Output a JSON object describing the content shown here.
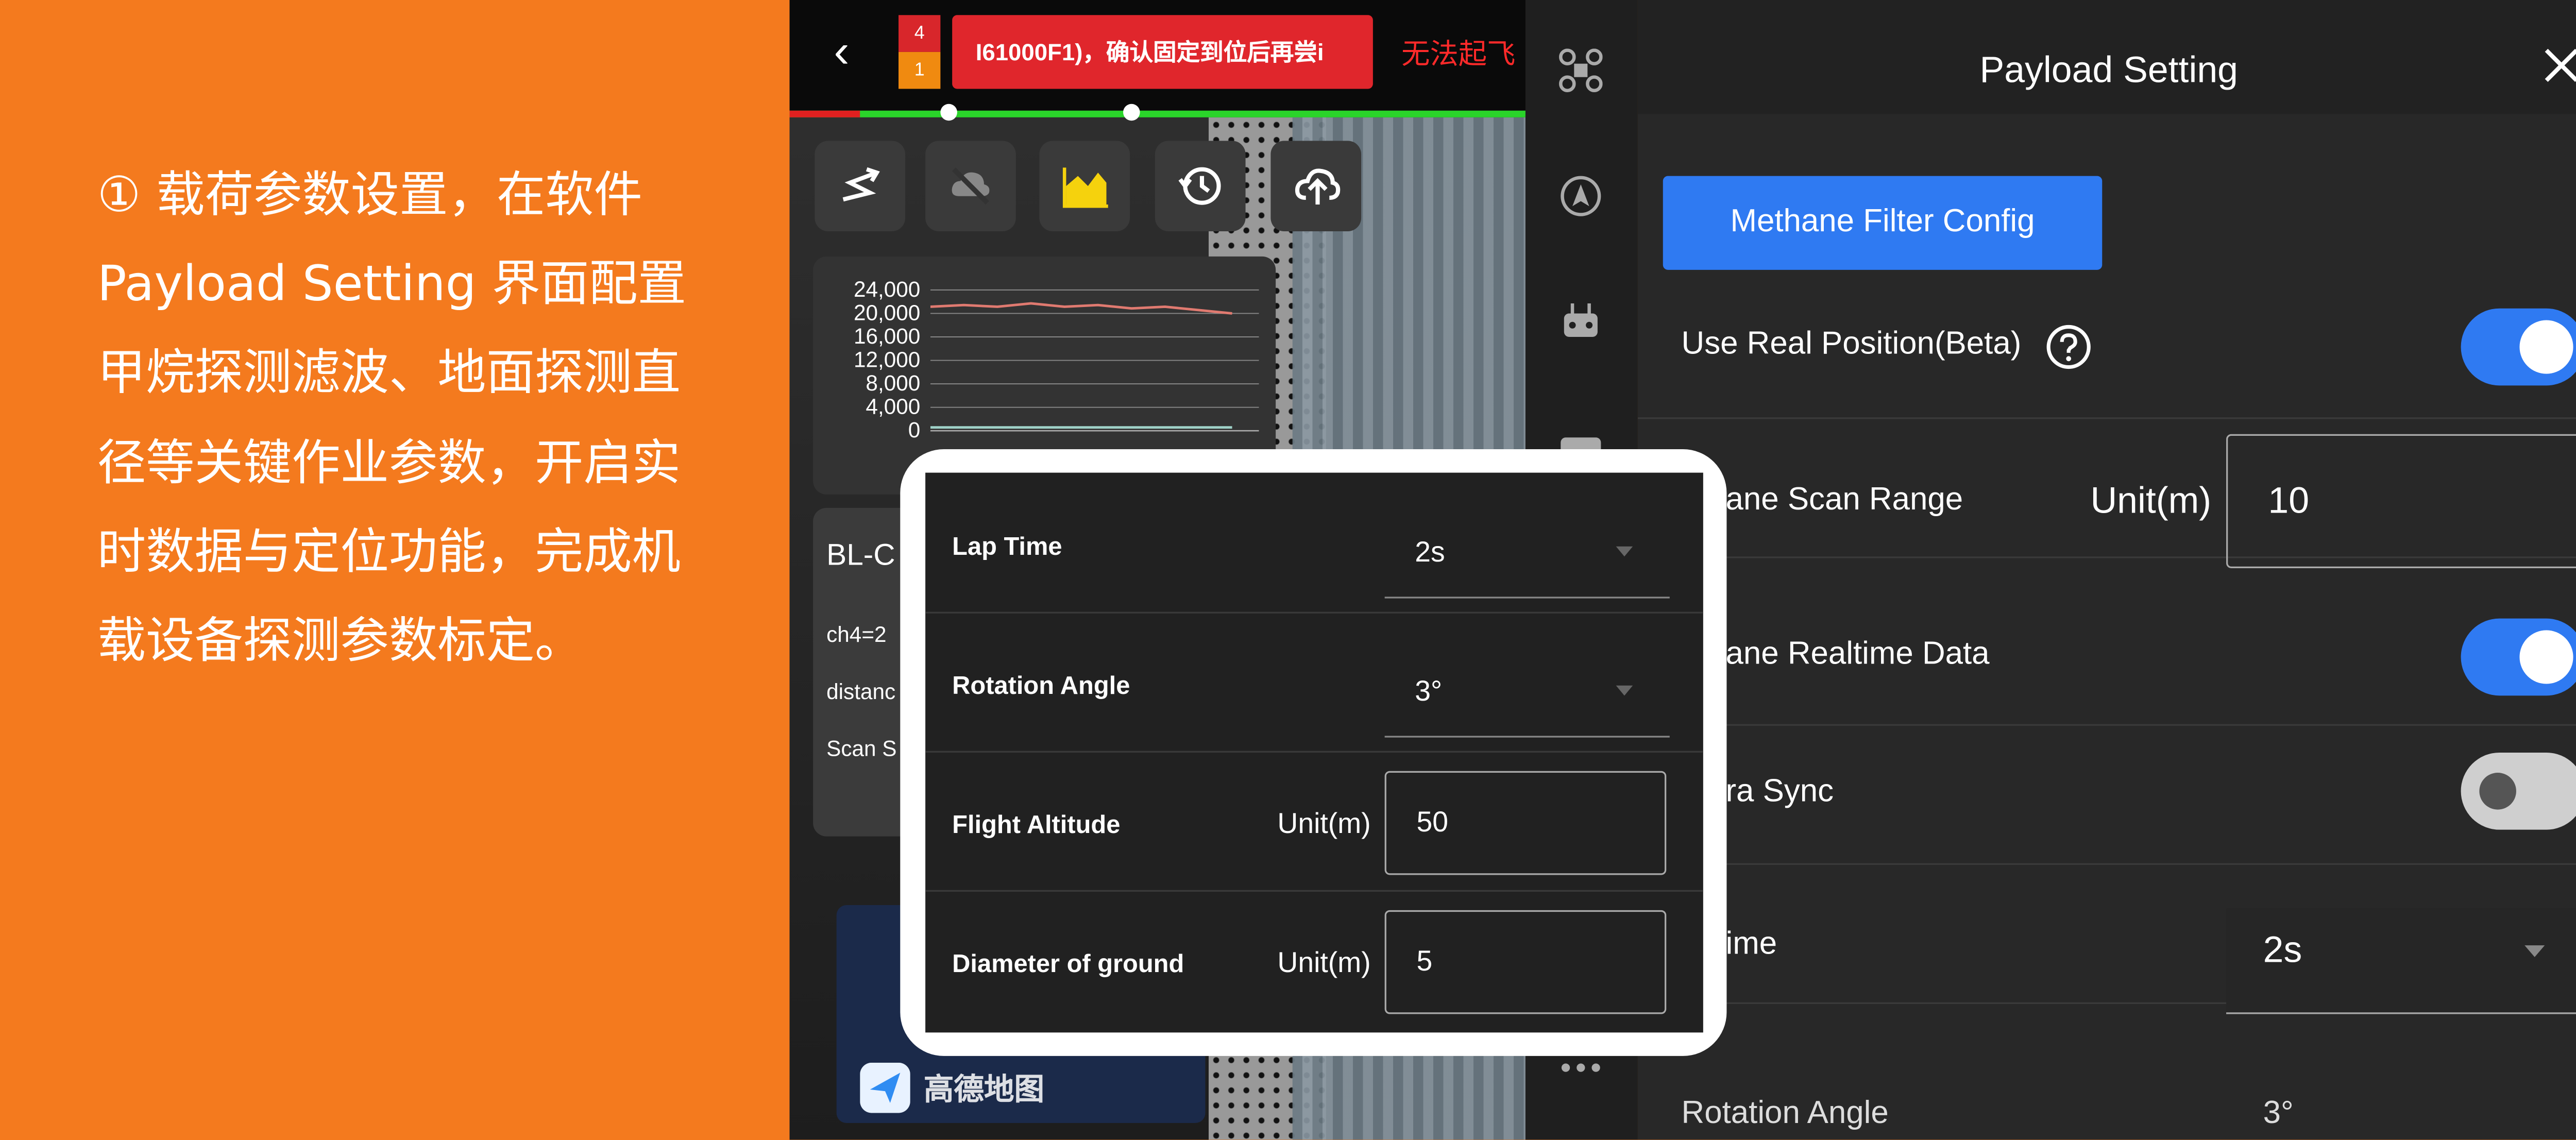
{
  "caption": {
    "lines": [
      "① 载荷参数设置，在软件",
      "Payload Setting 界面配置",
      "甲烷探测滤波、地面探测直",
      "径等关键作业参数，开启实",
      "时数据与定位功能，完成机",
      "载设备探测参数标定。"
    ]
  },
  "app": {
    "badge_top": "4",
    "badge_bottom": "1",
    "warning": "I61000F1)，确认固定到位后再尝i",
    "warning_red": "无法起飞",
    "chart": {
      "ticks": [
        "24,000",
        "20,000",
        "16,000",
        "12,000",
        "8,000",
        "4,000",
        "0"
      ]
    },
    "bl_title": "BL-C",
    "bl_lines": [
      "ch4=2",
      "distanc",
      "Scan S"
    ],
    "map_text": "高德地图"
  },
  "overlay": {
    "rows": [
      {
        "label": "Lap Time",
        "value": "2s"
      },
      {
        "label": "Rotation Angle",
        "value": "3°"
      },
      {
        "label": "Flight Altitude",
        "unit": "Unit(m)",
        "value": "50"
      },
      {
        "label": "Diameter of ground",
        "unit": "Unit(m)",
        "value": "5"
      }
    ]
  },
  "panel": {
    "title": "Payload Setting",
    "filter_button": "Methane Filter Config",
    "use_real_position": "Use Real Position(Beta)",
    "scan_range_label": "ethane Scan Range",
    "scan_range_unit": "Unit(m)",
    "scan_range_value": "10",
    "realtime_label": "ethane Realtime Data",
    "camera_sync_label": "mera Sync",
    "lap_time_label": "p Time",
    "lap_time_value": "2s",
    "rotation_label": "Rotation Angle",
    "rotation_value": "3°",
    "toggles": {
      "use_real_position": true,
      "realtime_data": true,
      "camera_sync": false
    }
  },
  "colors": {
    "orange": "#f47a1e",
    "accent_blue": "#2f7af2",
    "warning_red": "#e0262c"
  }
}
